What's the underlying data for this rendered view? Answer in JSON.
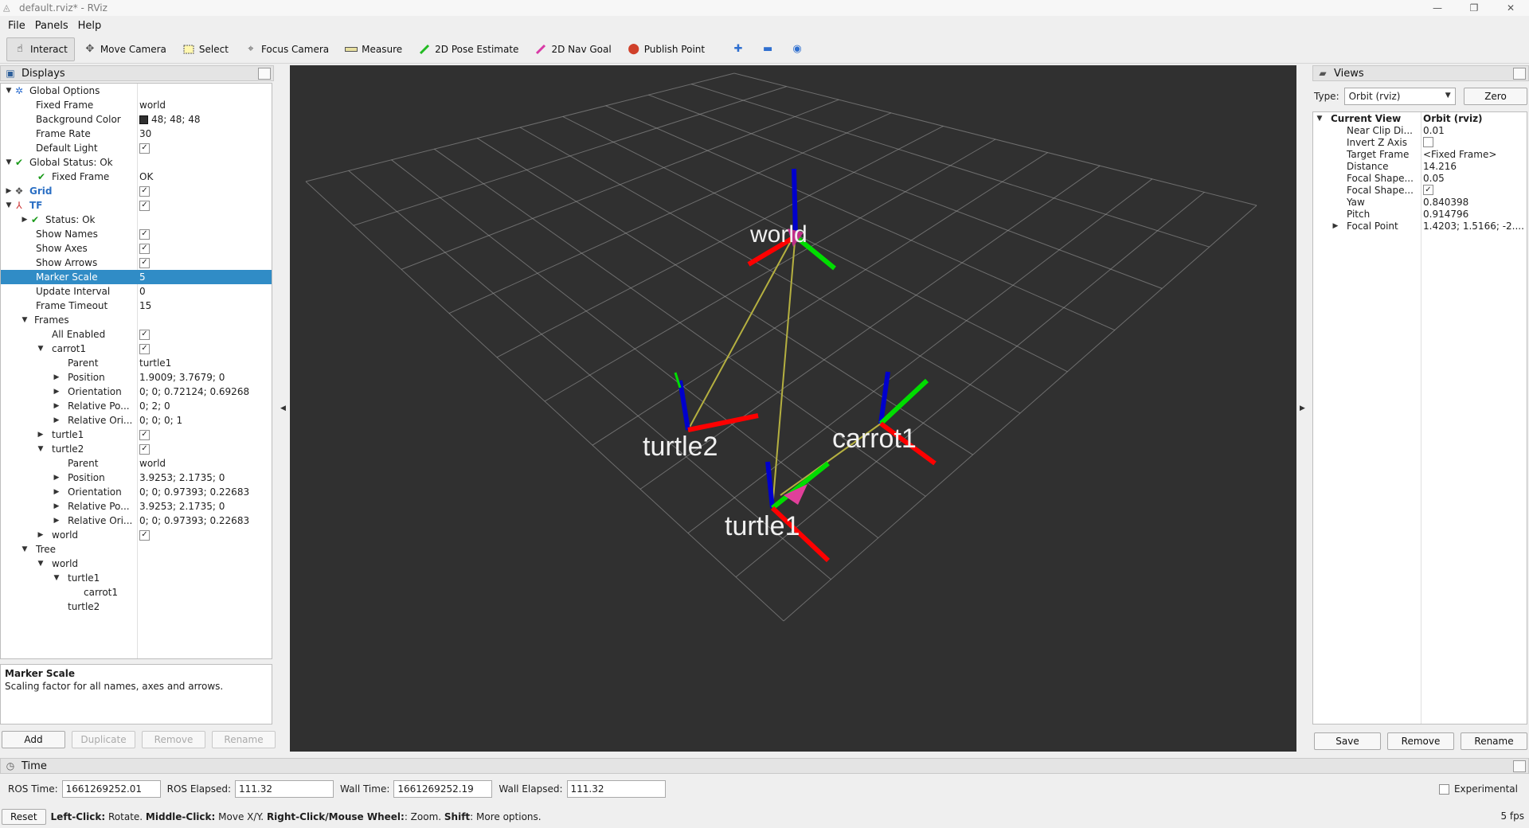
{
  "window": {
    "title": "default.rviz* - RViz",
    "minimize": "—",
    "restore": "❐",
    "close": "✕"
  },
  "menu": [
    "File",
    "Panels",
    "Help"
  ],
  "toolbar": {
    "interact": "Interact",
    "move_camera": "Move Camera",
    "select": "Select",
    "focus_camera": "Focus Camera",
    "measure": "Measure",
    "pose_estimate": "2D Pose Estimate",
    "nav_goal": "2D Nav Goal",
    "publish_point": "Publish Point"
  },
  "displays": {
    "title": "Displays",
    "rows": [
      {
        "name": "Global Options",
        "value": ""
      },
      {
        "name": "Fixed Frame",
        "value": "world"
      },
      {
        "name": "Background Color",
        "value": "48; 48; 48"
      },
      {
        "name": "Frame Rate",
        "value": "30"
      },
      {
        "name": "Default Light",
        "value": "✓"
      },
      {
        "name": "Global Status: Ok",
        "value": ""
      },
      {
        "name": "Fixed Frame",
        "value": "OK"
      },
      {
        "name": "Grid",
        "value": "✓"
      },
      {
        "name": "TF",
        "value": "✓"
      },
      {
        "name": "Status: Ok",
        "value": ""
      },
      {
        "name": "Show Names",
        "value": "✓"
      },
      {
        "name": "Show Axes",
        "value": "✓"
      },
      {
        "name": "Show Arrows",
        "value": "✓"
      },
      {
        "name": "Marker Scale",
        "value": "5"
      },
      {
        "name": "Update Interval",
        "value": "0"
      },
      {
        "name": "Frame Timeout",
        "value": "15"
      },
      {
        "name": "Frames",
        "value": ""
      },
      {
        "name": "All Enabled",
        "value": "✓"
      },
      {
        "name": "carrot1",
        "value": "✓"
      },
      {
        "name": "Parent",
        "value": "turtle1"
      },
      {
        "name": "Position",
        "value": "1.9009; 3.7679; 0"
      },
      {
        "name": "Orientation",
        "value": "0; 0; 0.72124; 0.69268"
      },
      {
        "name": "Relative Po...",
        "value": "0; 2; 0"
      },
      {
        "name": "Relative Ori...",
        "value": "0; 0; 0; 1"
      },
      {
        "name": "turtle1",
        "value": "✓"
      },
      {
        "name": "turtle2",
        "value": "✓"
      },
      {
        "name": "Parent",
        "value": "world"
      },
      {
        "name": "Position",
        "value": "3.9253; 2.1735; 0"
      },
      {
        "name": "Orientation",
        "value": "0; 0; 0.97393; 0.22683"
      },
      {
        "name": "Relative Po...",
        "value": "3.9253; 2.1735; 0"
      },
      {
        "name": "Relative Ori...",
        "value": "0; 0; 0.97393; 0.22683"
      },
      {
        "name": "world",
        "value": "✓"
      },
      {
        "name": "Tree",
        "value": ""
      },
      {
        "name": "world",
        "value": ""
      },
      {
        "name": "turtle1",
        "value": ""
      },
      {
        "name": "carrot1",
        "value": ""
      },
      {
        "name": "turtle2",
        "value": ""
      }
    ],
    "description_title": "Marker Scale",
    "description_text": "Scaling factor for all names, axes and arrows.",
    "buttons": {
      "add": "Add",
      "duplicate": "Duplicate",
      "remove": "Remove",
      "rename": "Rename"
    }
  },
  "scene": {
    "labels": {
      "world": "world",
      "turtle2": "turtle2",
      "carrot1": "carrot1",
      "turtle1": "turtle1"
    },
    "colors": {
      "background": "#303030",
      "grid": "#a0a0a0",
      "x_axis": "#ff0000",
      "y_axis": "#00dd00",
      "z_axis": "#0000cc",
      "link": "#b5b040",
      "arrow_head": "#e0409a"
    }
  },
  "views": {
    "title": "Views",
    "type_label": "Type:",
    "type_value": "Orbit (rviz)",
    "zero": "Zero",
    "rows": [
      {
        "name": "Current View",
        "value": "Orbit (rviz)"
      },
      {
        "name": "Near Clip Di...",
        "value": "0.01"
      },
      {
        "name": "Invert Z Axis",
        "value": ""
      },
      {
        "name": "Target Frame",
        "value": "<Fixed Frame>"
      },
      {
        "name": "Distance",
        "value": "14.216"
      },
      {
        "name": "Focal Shape...",
        "value": "0.05"
      },
      {
        "name": "Focal Shape...",
        "value": "✓"
      },
      {
        "name": "Yaw",
        "value": "0.840398"
      },
      {
        "name": "Pitch",
        "value": "0.914796"
      },
      {
        "name": "Focal Point",
        "value": "1.4203; 1.5166; -2...."
      }
    ],
    "buttons": {
      "save": "Save",
      "remove": "Remove",
      "rename": "Rename"
    }
  },
  "time": {
    "title": "Time",
    "ros_time_label": "ROS Time:",
    "ros_time": "1661269252.01",
    "ros_elapsed_label": "ROS Elapsed:",
    "ros_elapsed": "111.32",
    "wall_time_label": "Wall Time:",
    "wall_time": "1661269252.19",
    "wall_elapsed_label": "Wall Elapsed:",
    "wall_elapsed": "111.32",
    "experimental": "Experimental"
  },
  "status": {
    "reset": "Reset",
    "left_click": "Left-Click:",
    "left_click_desc": " Rotate. ",
    "middle_click": "Middle-Click:",
    "middle_click_desc": " Move X/Y. ",
    "right_click": "Right-Click/Mouse Wheel:",
    "right_click_desc": ": Zoom. ",
    "shift": "Shift",
    "shift_desc": ": More options.",
    "fps": "5 fps"
  }
}
